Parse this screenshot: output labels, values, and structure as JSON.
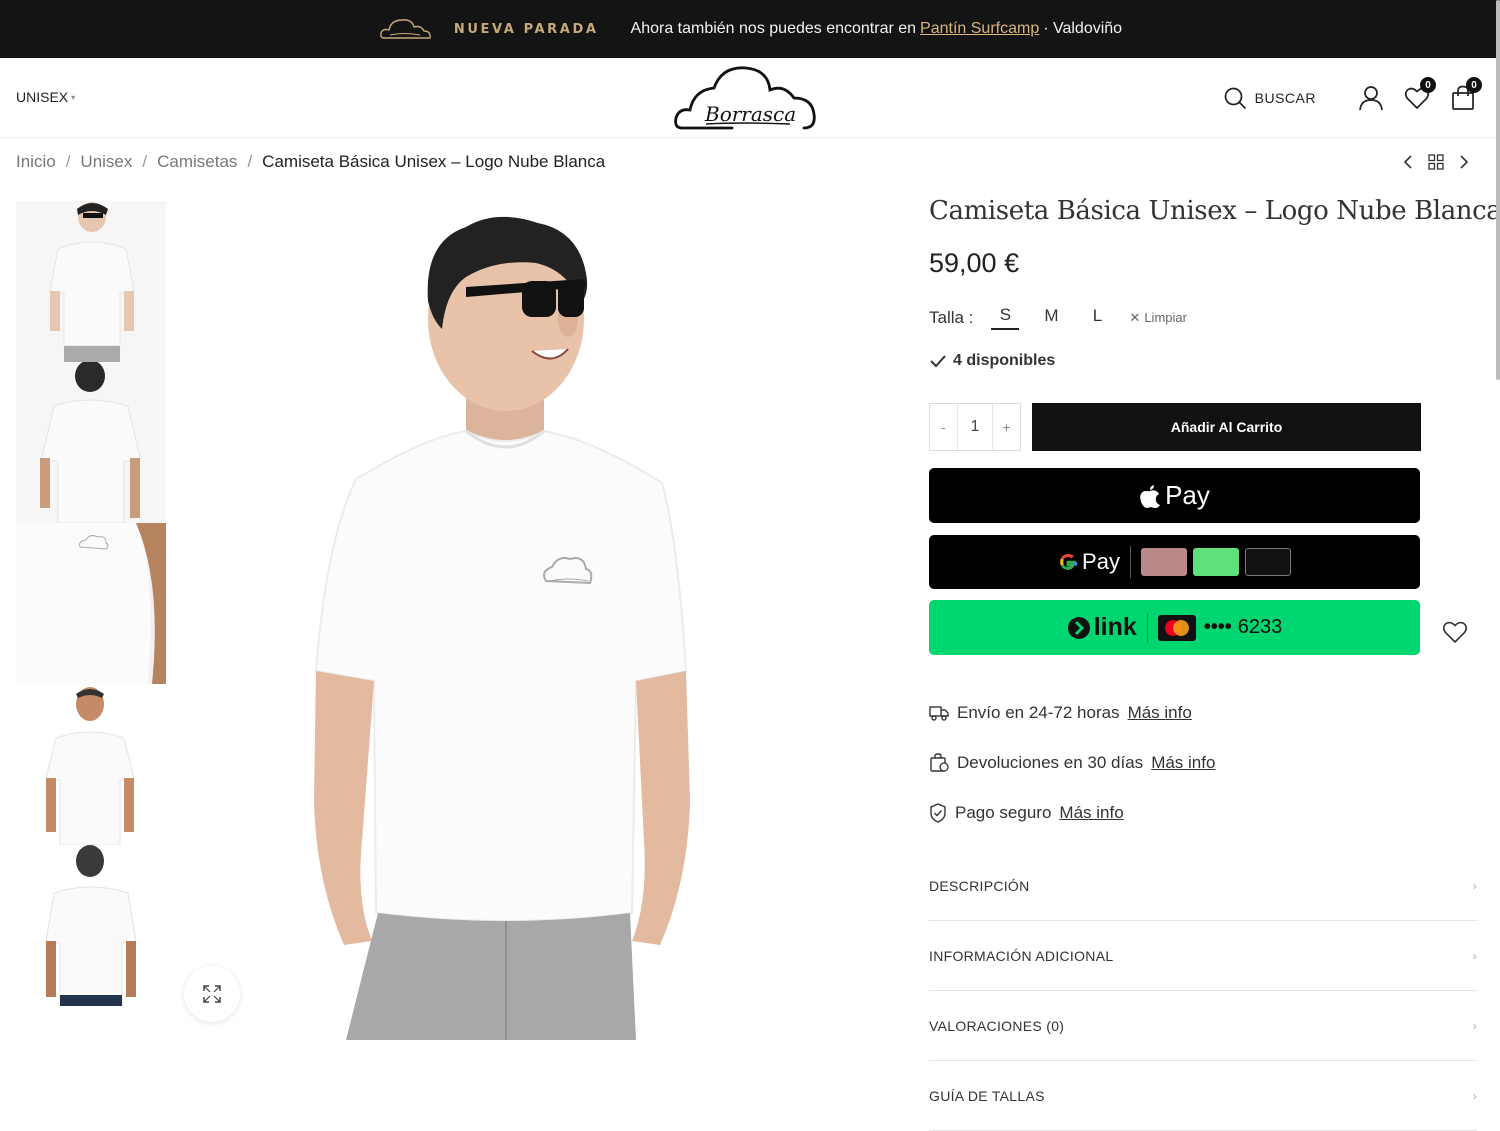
{
  "announcement": {
    "tag": "NUEVA PARADA",
    "text": "Ahora también nos puedes encontrar en",
    "link": "Pantín Surfcamp",
    "suffix": "· Valdoviño"
  },
  "header": {
    "nav_item": "UNISEX",
    "brand": "Borrasca",
    "search_label": "BUSCAR",
    "wishlist_count": "0",
    "cart_count": "0"
  },
  "breadcrumb": {
    "items": [
      "Inicio",
      "Unisex",
      "Camisetas"
    ],
    "separator": "/",
    "current": "Camiseta Básica Unisex – Logo Nube Blanca"
  },
  "product": {
    "title": "Camiseta Básica Unisex – Logo Nube Blanca",
    "price": "59,00 €",
    "size_label": "Talla :",
    "sizes": [
      "S",
      "M",
      "L"
    ],
    "selected_size": "S",
    "clear_label": "Limpiar",
    "stock": "4 disponibles",
    "quantity": "1",
    "qty_minus": "-",
    "qty_plus": "+",
    "add_to_cart": "Añadir Al Carrito"
  },
  "payments": {
    "apple_pay": "Pay",
    "google_pay": "Pay",
    "link_label": "link",
    "card_dots": "••••",
    "card_last4": "6233"
  },
  "info": [
    {
      "text": "Envío en 24-72 horas",
      "link": "Más info",
      "icon": "truck-icon"
    },
    {
      "text": "Devoluciones en 30 días",
      "link": "Más info",
      "icon": "return-bag-icon"
    },
    {
      "text": "Pago seguro",
      "link": "Más info",
      "icon": "shield-check-icon"
    }
  ],
  "accordion": [
    "DESCRIPCIÓN",
    "INFORMACIÓN ADICIONAL",
    "VALORACIONES (0)",
    "GUÍA DE TALLAS"
  ],
  "colors": {
    "topbar_bg": "#141414",
    "accent_gold": "#d9b47e",
    "link_green": "#00d66f",
    "button_black": "#111111"
  }
}
